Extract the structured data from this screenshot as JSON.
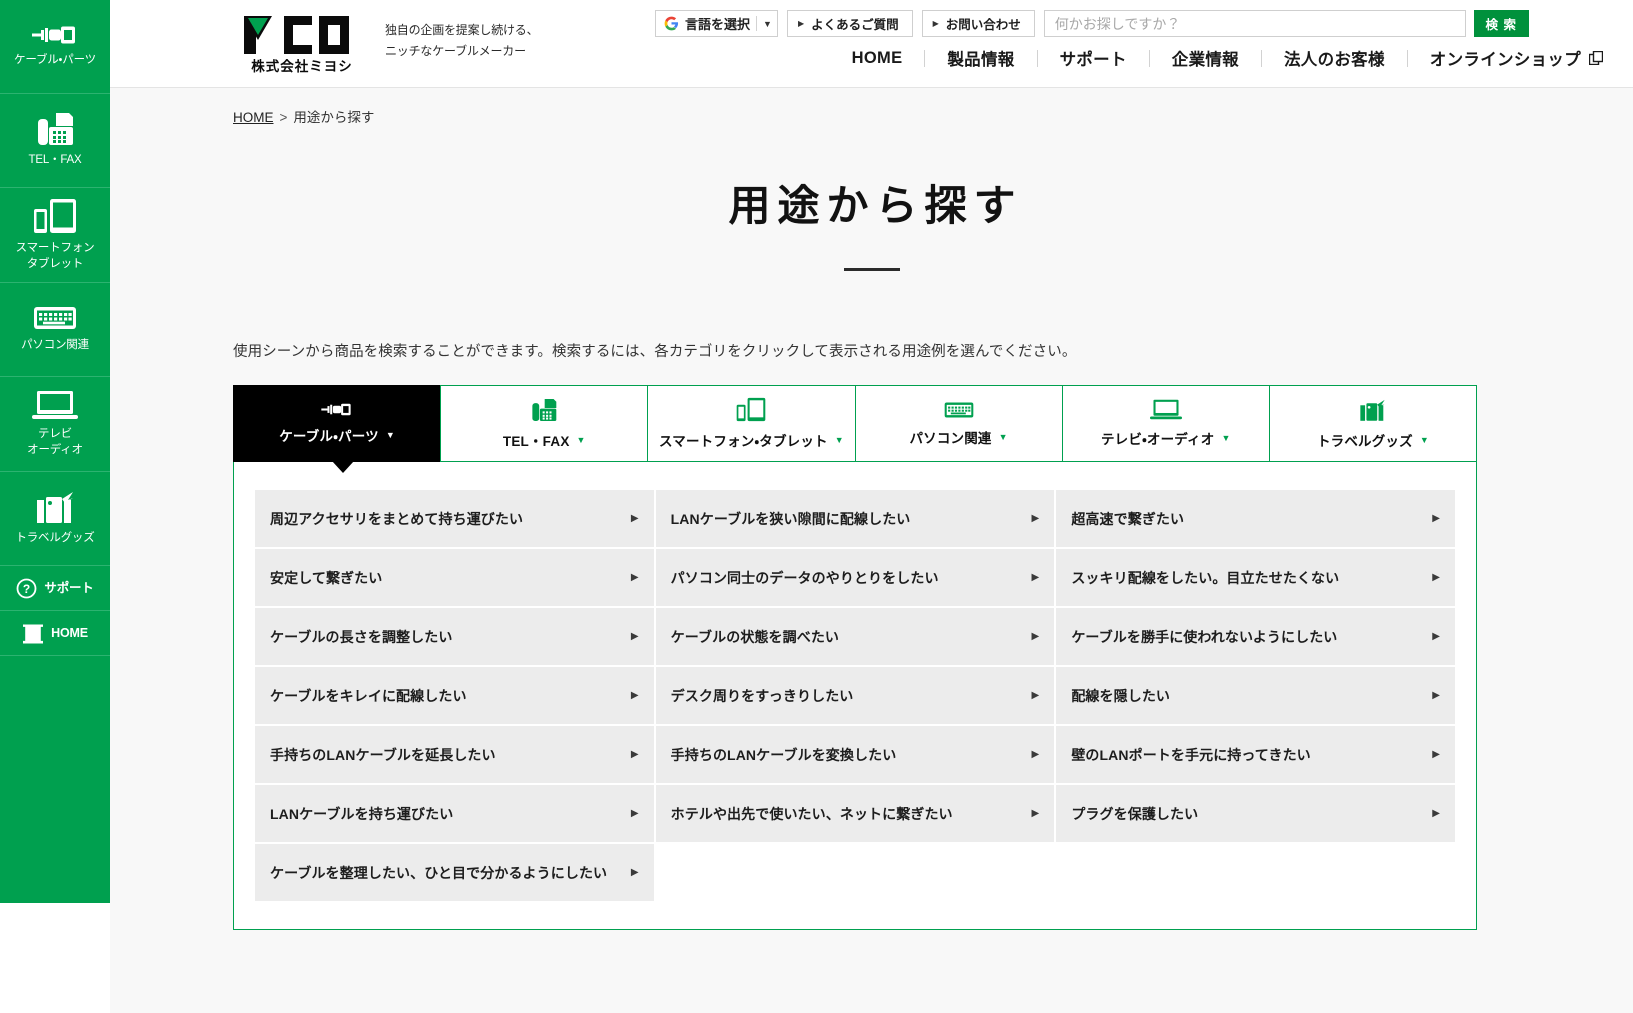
{
  "sidebar": {
    "items": [
      {
        "label": "ケーブル・パーツ",
        "icon": "cable-icon"
      },
      {
        "label": "TEL・FAX",
        "icon": "fax-icon"
      },
      {
        "label": "スマートフォン\nタブレット",
        "icon": "smartphone-tablet-icon"
      },
      {
        "label": "パソコン関連",
        "icon": "keyboard-icon"
      },
      {
        "label": "テレビ\nオーディオ",
        "icon": "monitor-icon"
      },
      {
        "label": "トラベルグッズ",
        "icon": "suitcase-icon"
      },
      {
        "label": "サポート",
        "icon": "question-circle-icon"
      },
      {
        "label": "HOME",
        "icon": "mco-mark-icon"
      }
    ]
  },
  "header": {
    "logo_text": "MCO",
    "logo_company": "株式会社ミヨシ",
    "tagline": "独自の企画を提案し続ける、\nニッチなケーブルメーカー",
    "language_select": "言語を選択",
    "faq_label": "よくあるご質問",
    "contact_label": "お問い合わせ",
    "search": {
      "placeholder": "何かお探しですか？",
      "value": "",
      "button_label": "検 索"
    },
    "nav": [
      "HOME",
      "製品情報",
      "サポート",
      "企業情報",
      "法人のお客様",
      "オンラインショップ"
    ]
  },
  "breadcrumb": {
    "home": "HOME",
    "separator": ">",
    "current": "用途から探す"
  },
  "main": {
    "title": "用途から探す",
    "lede": "使用シーンから商品を検索することができます。検索するには、各カテゴリをクリックして表示される用途例を選んでください。",
    "tabs": [
      {
        "label": "ケーブル・パーツ",
        "icon": "cable-icon",
        "active": true
      },
      {
        "label": "TEL・FAX",
        "icon": "fax-icon",
        "active": false
      },
      {
        "label": "スマートフォン・タブレット",
        "icon": "smartphone-tablet-icon",
        "active": false
      },
      {
        "label": "パソコン関連",
        "icon": "keyboard-icon",
        "active": false
      },
      {
        "label": "テレビ・オーディオ",
        "icon": "monitor-icon",
        "active": false
      },
      {
        "label": "トラベルグッズ",
        "icon": "suitcase-icon",
        "active": false
      }
    ],
    "use_cases": [
      "周辺アクセサリをまとめて持ち運びたい",
      "LANケーブルを狭い隙間に配線したい",
      "超高速で繋ぎたい",
      "安定して繋ぎたい",
      "パソコン同士のデータのやりとりをしたい",
      "スッキリ配線をしたい。目立たせたくない",
      "ケーブルの長さを調整したい",
      "ケーブルの状態を調べたい",
      "ケーブルを勝手に使われないようにしたい",
      "ケーブルをキレイに配線したい",
      "デスク周りをすっきりしたい",
      "配線を隠したい",
      "手持ちのLANケーブルを延長したい",
      "手持ちのLANケーブルを変換したい",
      "壁のLANポートを手元に持ってきたい",
      "LANケーブルを持ち運びたい",
      "ホテルや出先で使いたい、ネットに繋ぎたい",
      "プラグを保護したい",
      "ケーブルを整理したい、ひと目で分かるようにしたい"
    ],
    "cell_arrow": "▶"
  },
  "colors": {
    "brand_green": "#00a04f",
    "search_green": "#00913c",
    "active_tab": "#000000",
    "cell_bg": "#ececec",
    "page_bg": "#f8f8f8"
  }
}
